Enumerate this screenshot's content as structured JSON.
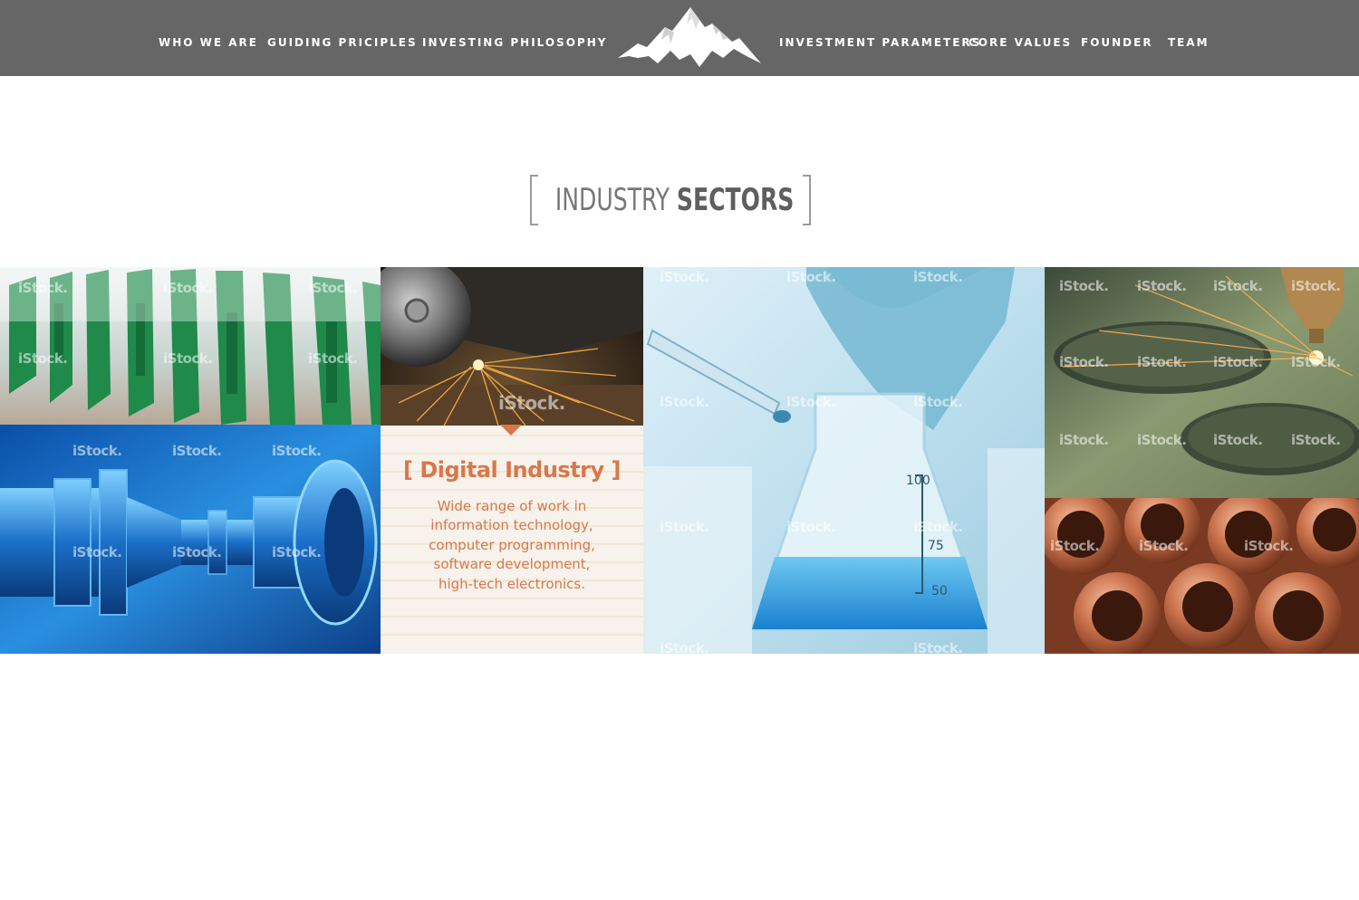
{
  "nav": {
    "left": [
      "WHO WE ARE",
      "GUIDING PRICIPLES",
      "INVESTING PHILOSOPHY"
    ],
    "right": [
      "INVESTMENT PARAMETERS",
      "CORE VALUES",
      "FOUNDER",
      "TEAM"
    ]
  },
  "section": {
    "title_light": "INDUSTRY",
    "title_bold": "SECTORS"
  },
  "card": {
    "heading": "[ Digital Industry ]",
    "lines": [
      "Wide range of work in",
      "information technology,",
      "computer programming,",
      "software development,",
      "high-tech electronics."
    ]
  },
  "watermark": "iStock.",
  "colors": {
    "header_bg": "#666666",
    "accent": "#d9774a",
    "title": "#666666"
  },
  "icons": {
    "logo": "mountain-logo-icon"
  }
}
